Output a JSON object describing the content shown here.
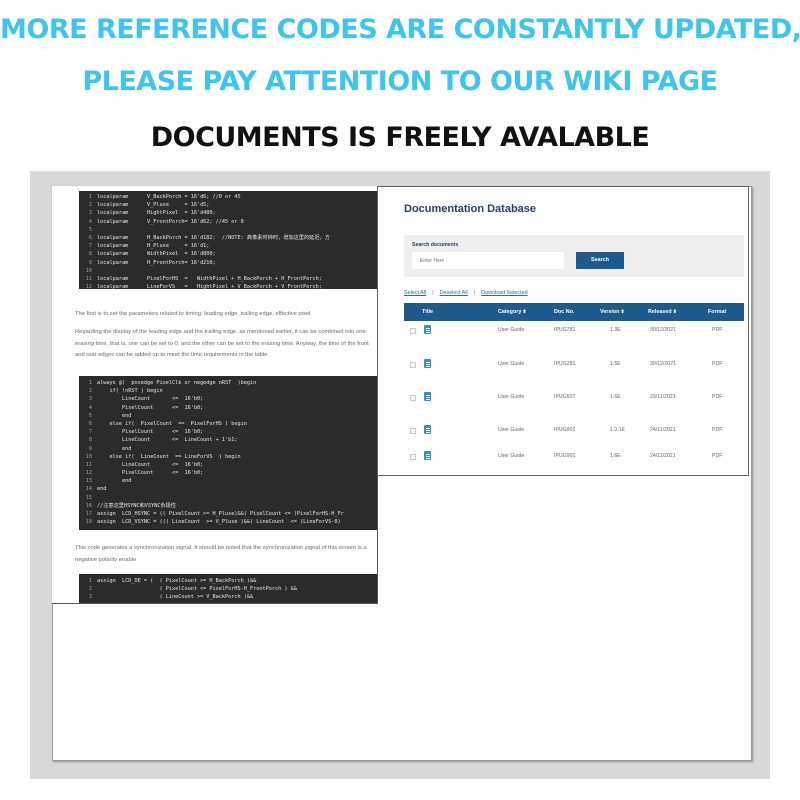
{
  "headlines": {
    "line1": "MORE REFERENCE CODES ARE CONSTANTLY UPDATED,",
    "line2": "PLEASE PAY ATTENTION TO OUR WIKI PAGE",
    "line3": "DOCUMENTS IS FREELY AVALABLE"
  },
  "colors": {
    "headline_accent": "#3fc4ec",
    "table_header": "#1e5a8c",
    "title": "#27406a"
  },
  "code_block_1": [
    {
      "n": "1",
      "t": "localparam      V_BackPorch = 16'd6; //0 or 45"
    },
    {
      "n": "2",
      "t": "localparam      V_Pluse     = 16'd5;"
    },
    {
      "n": "3",
      "t": "localparam      HightPixel  = 16'd480;"
    },
    {
      "n": "4",
      "t": "localparam      V_FrontPorch= 16'd62; //45 or 0"
    },
    {
      "n": "5",
      "t": ""
    },
    {
      "n": "6",
      "t": "localparam      H_BackPorch = 16'd182;  //NOTE: 高像素时钟时，增加这里的延迟，方"
    },
    {
      "n": "7",
      "t": "localparam      H_Pluse     = 16'd1;"
    },
    {
      "n": "8",
      "t": "localparam      WidthPixel  = 16'd800;"
    },
    {
      "n": "9",
      "t": "localparam      H_FrontPorch= 16'd210;"
    },
    {
      "n": "10",
      "t": ""
    },
    {
      "n": "11",
      "t": "localparam      PixelForHS  =   WidthPixel + H_BackPorch + H_FrontPorch;"
    },
    {
      "n": "12",
      "t": "localparam      LineForVS   =   HightPixel + V_BackPorch + V_FrontPorch;"
    }
  ],
  "doc_text_1": "The first is to set the parameters related to timing: leading edge, trailing edge, effective pixel",
  "doc_text_2": "Regarding the display of the leading edge and the trailing edge, as mentioned earlier, it can be combined into one erasing time, that is, one can be set to 0, and the other can be set to the erasing time. Anyway, the time of the front and rear edges can be added up to meet the time requirements in the table.",
  "code_block_2": [
    {
      "n": "1",
      "t": "always @(  posedge PixelClk or negedge nRST  )begin"
    },
    {
      "n": "2",
      "t": "    if( !nRST ) begin"
    },
    {
      "n": "3",
      "t": "        LineCount       <=  16'b0;"
    },
    {
      "n": "4",
      "t": "        PixelCount      <=  16'b0;"
    },
    {
      "n": "5",
      "t": "        end"
    },
    {
      "n": "6",
      "t": "    else if(  PixelCount  ==  PixelForHS ) begin"
    },
    {
      "n": "7",
      "t": "        PixelCount      <=  16'b0;"
    },
    {
      "n": "8",
      "t": "        LineCount       <=  LineCount + 1'b1;"
    },
    {
      "n": "9",
      "t": "        end"
    },
    {
      "n": "10",
      "t": "    else if(  LineCount  == LineForVS  ) begin"
    },
    {
      "n": "11",
      "t": "        LineCount       <=  16'b0;"
    },
    {
      "n": "12",
      "t": "        PixelCount      <=  16'b0;"
    },
    {
      "n": "13",
      "t": "        end"
    },
    {
      "n": "14",
      "t": "end"
    },
    {
      "n": "15",
      "t": ""
    },
    {
      "n": "16",
      "t": "//注意这里HSYNC和VSYNC负极性"
    },
    {
      "n": "17",
      "t": "assign  LCD_HSYNC = (( PixelCount >= H_Pluse)&&( PixelCount <= (PixelForHS-H_Fr"
    },
    {
      "n": "18",
      "t": "assign  LCD_VSYNC = ((( LineCount  >= V_Pluse )&&( LineCount  <= (LineForVS-0)"
    }
  ],
  "doc_text_3": "This code generates a synchronization signal. It should be noted that the synchronization signal of this screen is a negative polarity enable",
  "code_block_3": [
    {
      "n": "1",
      "t": "assign  LCD_DE = (  ( PixelCount >= H_BackPorch )&&"
    },
    {
      "n": "2",
      "t": "                    ( PixelCount <= PixelForHS-H_FrontPorch ) &&"
    },
    {
      "n": "3",
      "t": "                    ( LineCount >= V_BackPorch )&&"
    }
  ],
  "db": {
    "title": "Documentation Database",
    "search_label": "Search documents",
    "search_placeholder": "Enter Here",
    "search_button": "Search",
    "select_all": "Select All",
    "deselect_all": "Deselect All",
    "download_selected": "Download Selected",
    "separator": "|",
    "columns": {
      "title": "Title",
      "category": "Category",
      "doc_no": "Doc No.",
      "version": "Version",
      "released": "Released",
      "format": "Format"
    },
    "sort_glyph": "⬍",
    "rows": [
      {
        "category": "User Guide",
        "doc_no": "IPUG781",
        "version": "1.3E",
        "released": "30/12/2021",
        "format": "PDF"
      },
      {
        "category": "User Guide",
        "doc_no": "IPUG281",
        "version": "1.5E",
        "released": "30/12/2021",
        "format": "PDF"
      },
      {
        "category": "User Guide",
        "doc_no": "IPUG507",
        "version": "1.6E",
        "released": "29/11/2021",
        "format": "PDF"
      },
      {
        "category": "User Guide",
        "doc_no": "IPUG902",
        "version": "1.0.1E",
        "released": "24/11/2021",
        "format": "PDF"
      },
      {
        "category": "User Guide",
        "doc_no": "IPUG901",
        "version": "1.6E",
        "released": "24/11/2021",
        "format": "PDF"
      }
    ]
  }
}
